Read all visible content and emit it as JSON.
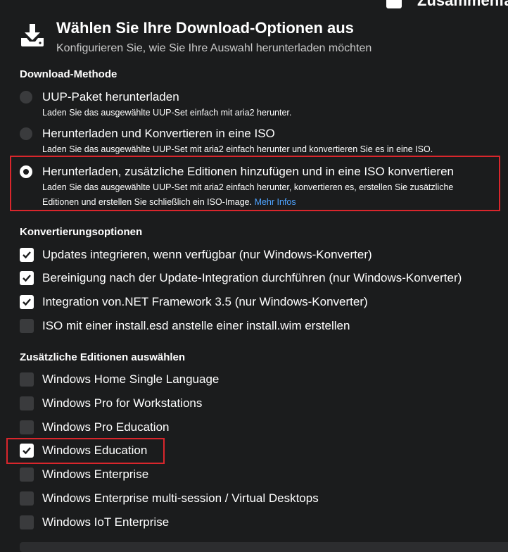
{
  "top_cut": {
    "label": "Zusammenfass"
  },
  "header": {
    "title": "Wählen Sie Ihre Download-Optionen aus",
    "subtitle": "Konfigurieren Sie, wie Sie Ihre Auswahl herunterladen möchten",
    "icon": "download-icon"
  },
  "download_method": {
    "title": "Download-Methode",
    "options": [
      {
        "label": "UUP-Paket herunterladen",
        "desc": "Laden Sie das ausgewählte UUP-Set einfach mit aria2 herunter.",
        "selected": false
      },
      {
        "label": "Herunterladen und Konvertieren in eine ISO",
        "desc": "Laden Sie das ausgewählte UUP-Set mit aria2 einfach herunter und konvertieren Sie es in eine ISO.",
        "selected": false
      },
      {
        "label": "Herunterladen, zusätzliche Editionen hinzufügen und in eine ISO konvertieren",
        "desc": "Laden Sie das ausgewählte UUP-Set mit aria2 einfach herunter, konvertieren es, erstellen Sie zusätzliche Editionen und erstellen Sie schließlich ein ISO-Image.",
        "link": "Mehr Infos",
        "selected": true
      }
    ]
  },
  "conversion": {
    "title": "Konvertierungsoptionen",
    "options": [
      {
        "label": "Updates integrieren, wenn verfügbar (nur Windows-Konverter)",
        "checked": true
      },
      {
        "label": "Bereinigung nach der Update-Integration durchführen (nur Windows-Konverter)",
        "checked": true
      },
      {
        "label": "Integration von.NET Framework 3.5 (nur Windows-Konverter)",
        "checked": true
      },
      {
        "label": "ISO mit einer install.esd anstelle einer install.wim erstellen",
        "checked": false
      }
    ]
  },
  "editions": {
    "title": "Zusätzliche Editionen auswählen",
    "options": [
      {
        "label": "Windows Home Single Language",
        "checked": false
      },
      {
        "label": "Windows Pro for Workstations",
        "checked": false
      },
      {
        "label": "Windows Pro Education",
        "checked": false
      },
      {
        "label": "Windows Education",
        "checked": true
      },
      {
        "label": "Windows Enterprise",
        "checked": false
      },
      {
        "label": "Windows Enterprise multi-session / Virtual Desktops",
        "checked": false
      },
      {
        "label": "Windows IoT Enterprise",
        "checked": false
      }
    ]
  },
  "colors": {
    "background": "#1b1c1d",
    "highlight": "#d9262c",
    "link": "#4ea3ff",
    "unchecked": "#3a3b3d"
  }
}
